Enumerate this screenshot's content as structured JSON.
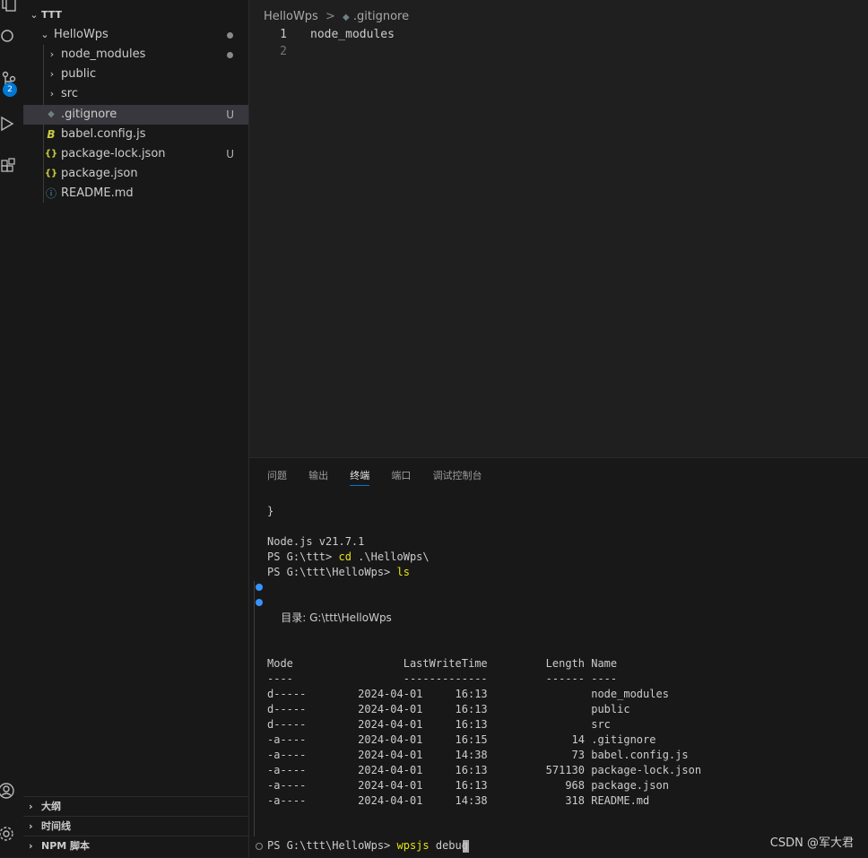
{
  "activity": {
    "icons": [
      "explorer-icon",
      "search-icon",
      "source-control-icon",
      "run-debug-icon",
      "extensions-icon",
      "accounts-icon",
      "settings-icon"
    ],
    "badge": "2"
  },
  "explorer": {
    "root": "TTT",
    "project": "HelloWps",
    "items": [
      {
        "label": "node_modules",
        "kind": "folder",
        "deco": "dot"
      },
      {
        "label": "public",
        "kind": "folder",
        "deco": ""
      },
      {
        "label": "src",
        "kind": "folder",
        "deco": ""
      },
      {
        "label": ".gitignore",
        "kind": "gitignore",
        "deco": "U",
        "icon": "◆"
      },
      {
        "label": "babel.config.js",
        "kind": "babel",
        "deco": "",
        "icon": "B"
      },
      {
        "label": "package-lock.json",
        "kind": "json",
        "deco": "U",
        "icon": "{}"
      },
      {
        "label": "package.json",
        "kind": "json",
        "deco": "",
        "icon": "{}"
      },
      {
        "label": "README.md",
        "kind": "info",
        "deco": "",
        "icon": "ⓘ"
      }
    ],
    "sections": [
      "大纲",
      "时间线",
      "NPM 脚本"
    ]
  },
  "editor": {
    "breadcrumb": [
      "HelloWps",
      ".gitignore"
    ],
    "breadcrumb_sep": ">",
    "lines": [
      {
        "num": "1",
        "text": "node_modules"
      },
      {
        "num": "2",
        "text": ""
      }
    ]
  },
  "panel": {
    "tabs": [
      "问题",
      "输出",
      "终端",
      "端口",
      "调试控制台"
    ],
    "active_tab": "终端",
    "terminal": {
      "brace": "}",
      "node_version": "Node.js v21.7.1",
      "prompt1": "PS G:\\ttt> ",
      "cmd1": "cd",
      "arg1": " .\\HelloWps\\",
      "prompt2": "PS G:\\ttt\\HelloWps> ",
      "cmd2": "ls",
      "dir_label": "    目录: G:\\ttt\\HelloWps",
      "header": "Mode                 LastWriteTime         Length Name",
      "divider": "----                 -------------         ------ ----",
      "rows": [
        "d-----        2024-04-01     16:13                node_modules",
        "d-----        2024-04-01     16:13                public",
        "d-----        2024-04-01     16:13                src",
        "-a----        2024-04-01     16:15             14 .gitignore",
        "-a----        2024-04-01     14:38             73 babel.config.js",
        "-a----        2024-04-01     16:13         571130 package-lock.json",
        "-a----        2024-04-01     16:13            968 package.json",
        "-a----        2024-04-01     14:38            318 README.md"
      ],
      "prompt3": "PS G:\\ttt\\HelloWps> ",
      "cmd3": "wpsjs",
      "arg3": " debug"
    }
  },
  "watermark": "CSDN @军大君"
}
